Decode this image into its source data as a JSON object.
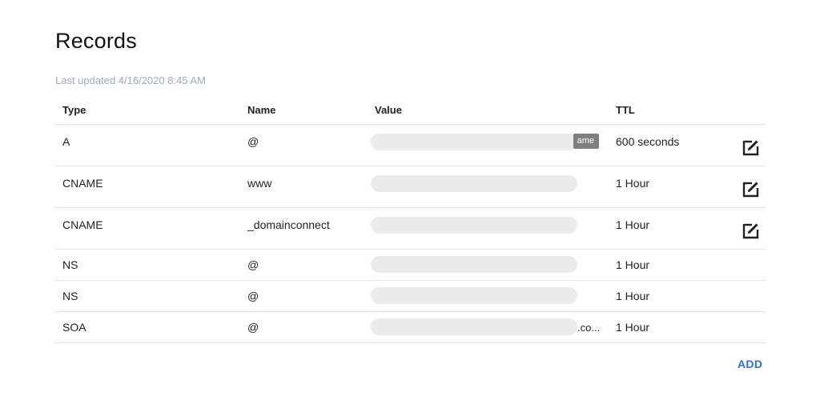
{
  "page": {
    "title": "Records",
    "last_updated": "Last updated 4/16/2020 8:45 AM",
    "add_label": "ADD"
  },
  "columns": {
    "type": "Type",
    "name": "Name",
    "value": "Value",
    "ttl": "TTL"
  },
  "records": [
    {
      "type": "A",
      "name": "@",
      "value_visible": "ame",
      "ttl": "600 seconds",
      "editable": true
    },
    {
      "type": "CNAME",
      "name": "www",
      "ttl": "1 Hour",
      "editable": true
    },
    {
      "type": "CNAME",
      "name": "_domainconnect",
      "ttl": "1 Hour",
      "editable": true
    },
    {
      "type": "NS",
      "name": "@",
      "ttl": "1 Hour",
      "editable": false
    },
    {
      "type": "NS",
      "name": "@",
      "ttl": "1 Hour",
      "editable": false
    },
    {
      "type": "SOA",
      "name": "@",
      "value_visible": ".co...",
      "ttl": "1 Hour",
      "editable": false
    }
  ],
  "icons": {
    "edit": "edit-icon"
  },
  "colors": {
    "accent": "#2f6fd0",
    "muted_text": "#a3aab3",
    "redacted_bar": "#ebebeb"
  }
}
